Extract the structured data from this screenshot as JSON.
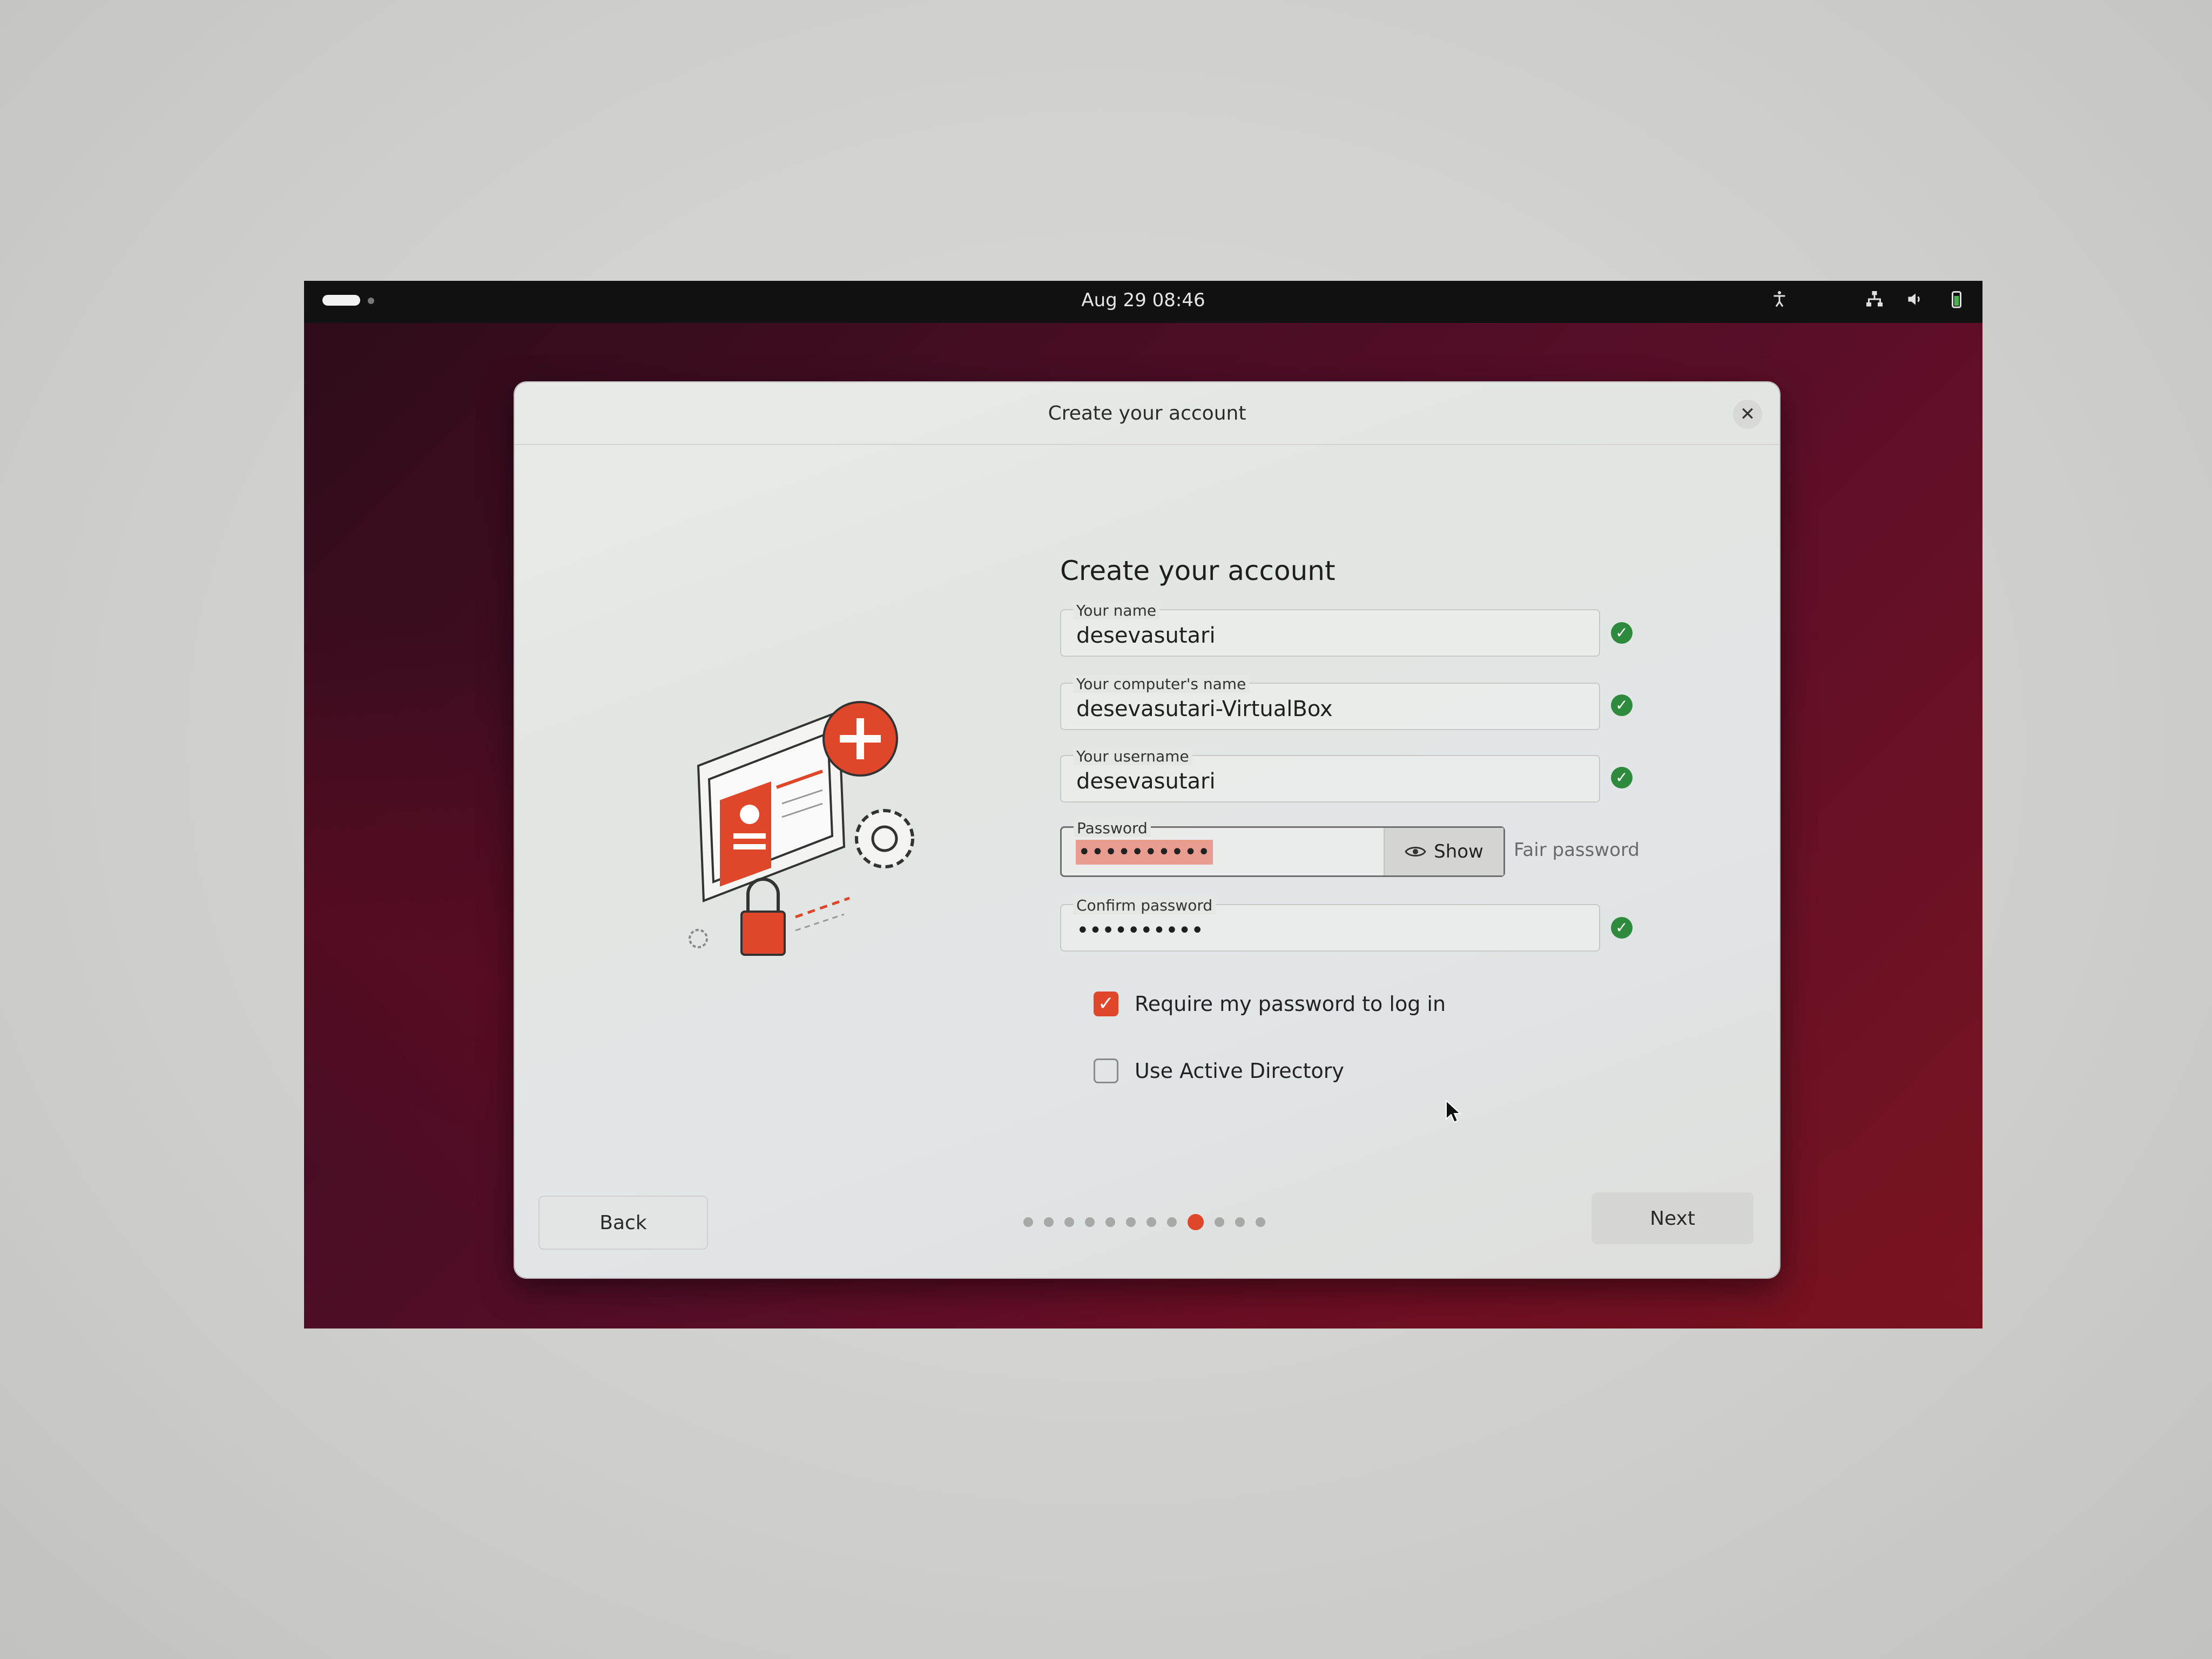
{
  "topbar": {
    "clock": "Aug 29  08:46"
  },
  "dialog": {
    "title": "Create your account",
    "heading": "Create your account",
    "fields": [
      {
        "label": "Your name",
        "value": "desevasutari"
      },
      {
        "label": "Your computer's name",
        "value": "desevasutari-VirtualBox"
      },
      {
        "label": "Your username",
        "value": "desevasutari"
      }
    ],
    "password": {
      "label": "Password",
      "value": "••••••••••",
      "show_label": "Show",
      "strength": "Fair password"
    },
    "confirm": {
      "label": "Confirm password",
      "value": "••••••••••"
    },
    "options": [
      {
        "label": "Require my password to log in",
        "checked": true
      },
      {
        "label": "Use Active Directory",
        "checked": false
      }
    ],
    "back_label": "Back",
    "next_label": "Next",
    "progress": {
      "total": 12,
      "current": 9
    }
  },
  "colors": {
    "accent": "#e0472a",
    "valid": "#2e8b3e"
  }
}
